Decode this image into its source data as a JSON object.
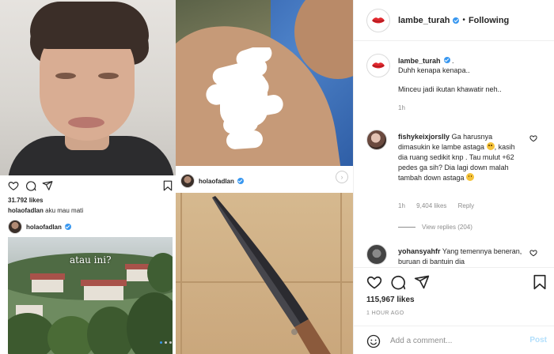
{
  "collage": {
    "post1": {
      "likes": "31.792 likes",
      "caption_user": "holaofadlan",
      "caption_text": "aku mau mati"
    },
    "post2": {
      "username": "holaofadlan",
      "image_text": "atau ini?"
    },
    "post3": {
      "username": "holaofadlan",
      "next_arrow": "›"
    }
  },
  "post": {
    "header": {
      "username": "lambe_turah",
      "separator": "•",
      "follow_status": "Following"
    },
    "caption": {
      "username": "lambe_turah",
      "suffix": ".",
      "line1": "Duhh kenapa kenapa..",
      "line2": "Minceu jadi ikutan khawatir neh..",
      "time": "1h"
    },
    "comments": [
      {
        "username": "fishykeixjorslly",
        "text_part1": "Ga harusnya dimasukin ke lambe astaga",
        "text_part2": ", kasih dia ruang sedikit knp . Tau mulut +62 pedes ga sih? Dia lagi down malah tambah down astaga",
        "time": "1h",
        "likes": "9,404 likes",
        "reply": "Reply",
        "view_replies": "View replies (204)"
      },
      {
        "username": "yohansyahfr",
        "text": "Yang temennya beneran, buruan di bantuin dia"
      }
    ],
    "likes": "115,967 likes",
    "time_ago": "1 HOUR AGO",
    "add_comment_placeholder": "Add a comment...",
    "post_label": "Post"
  },
  "colors": {
    "brand_red": "#e0282e",
    "verified_blue": "#3897f0",
    "post_button_disabled": "#b2dffc",
    "muted_text": "#8e8e8e"
  },
  "icons": [
    "heart-icon",
    "comment-icon",
    "share-icon",
    "bookmark-icon",
    "smile-icon",
    "verified-icon",
    "lips-logo-icon"
  ]
}
